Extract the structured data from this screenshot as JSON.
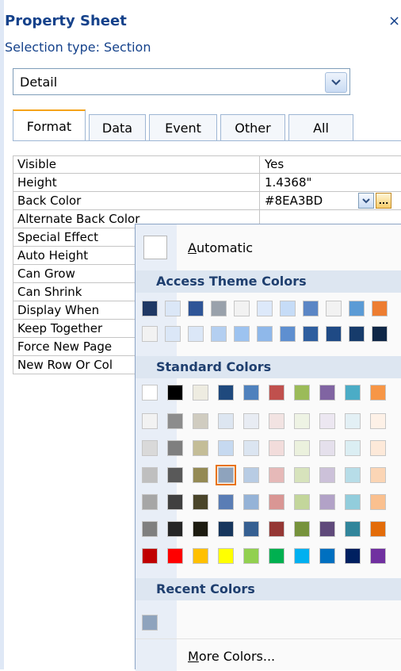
{
  "header": {
    "title": "Property Sheet",
    "close_glyph": "×",
    "selection_type": "Selection type:  Section"
  },
  "selector": {
    "value": "Detail"
  },
  "tabs": [
    "Format",
    "Data",
    "Event",
    "Other",
    "All"
  ],
  "active_tab": "Format",
  "properties": [
    {
      "name": "Visible",
      "value": "Yes"
    },
    {
      "name": "Height",
      "value": "1.4368\""
    },
    {
      "name": "Back Color",
      "value": "#8EA3BD"
    },
    {
      "name": "Alternate Back Color",
      "value": ""
    },
    {
      "name": "Special Effect",
      "value": ""
    },
    {
      "name": "Auto Height",
      "value": ""
    },
    {
      "name": "Can Grow",
      "value": ""
    },
    {
      "name": "Can Shrink",
      "value": ""
    },
    {
      "name": "Display When",
      "value": ""
    },
    {
      "name": "Keep Together",
      "value": ""
    },
    {
      "name": "Force New Page",
      "value": ""
    },
    {
      "name": "New Row Or Col",
      "value": ""
    }
  ],
  "color_picker": {
    "automatic_prefix": "A",
    "automatic_rest": "utomatic",
    "theme_header": "Access Theme Colors",
    "standard_header": "Standard Colors",
    "recent_header": "Recent Colors",
    "more_prefix": "M",
    "more_rest": "ore Colors...",
    "theme_rows": [
      [
        "#1f3864",
        "#dbe7f7",
        "#2f5597",
        "#99a1ab",
        "#f2f2f2",
        "#dde9fa",
        "#c6dcf7",
        "#5b86c5",
        "#f2f2f2",
        "#5b9bd5",
        "#ed7d31"
      ],
      [
        "#f2f2f2",
        "#dbe7f7",
        "#dbe7f7",
        "#b4cff1",
        "#9dc3f0",
        "#8fb8ea",
        "#5e8fd0",
        "#2e5e9f",
        "#1f4a85",
        "#163b6b",
        "#0f2747"
      ]
    ],
    "standard_rows": [
      [
        "#ffffff",
        "#000000",
        "#eeece1",
        "#1f497d",
        "#4f81bd",
        "#c0504d",
        "#9bbb59",
        "#8064a2",
        "#4bacc6",
        "#f79646"
      ],
      [
        "#f2f2f2",
        "#8c8c8c",
        "#d0ccc0",
        "#dde6f1",
        "#e8ecf3",
        "#f2e3e2",
        "#eef3e4",
        "#ece7f1",
        "#e3f0f5",
        "#fdf1e7"
      ],
      [
        "#d9d9d9",
        "#7f7f7f",
        "#c4bd97",
        "#c6d9f0",
        "#dbe5f1",
        "#f2dcdb",
        "#ebf1dd",
        "#e5e0ec",
        "#dbeef3",
        "#fde9d9"
      ],
      [
        "#bfbfbf",
        "#595959",
        "#948a54",
        "#8ea3bd",
        "#b8cce4",
        "#e6b9b8",
        "#d7e3bc",
        "#ccc1d9",
        "#b7dde8",
        "#fbd5b5"
      ],
      [
        "#a6a6a6",
        "#404040",
        "#4a452a",
        "#5a7db5",
        "#95b3d7",
        "#d99694",
        "#c3d69b",
        "#b2a2c7",
        "#92cddc",
        "#fac08f"
      ],
      [
        "#7f7f7f",
        "#262626",
        "#1d1b10",
        "#17365d",
        "#366092",
        "#953734",
        "#76923c",
        "#5f497a",
        "#31859b",
        "#e36c09"
      ],
      [
        "#c00000",
        "#ff0000",
        "#ffc000",
        "#ffff00",
        "#92d050",
        "#00b050",
        "#00b0f0",
        "#0070c0",
        "#002060",
        "#7030a0"
      ]
    ],
    "selected": "#8ea3bd",
    "recent": [
      "#8ea3bd"
    ]
  }
}
